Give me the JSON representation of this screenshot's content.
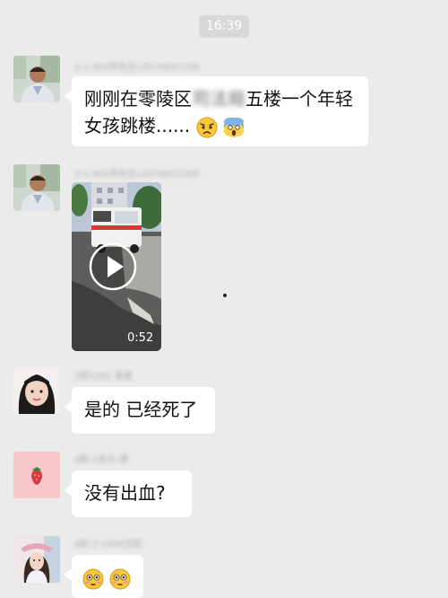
{
  "timestamp": "16:39",
  "messages": [
    {
      "sender": "2-1-403李先生13574651339",
      "text_before": "刚刚在零陵区",
      "text_blurred": "司法局",
      "text_after": "五楼一个年轻女孩跳楼......",
      "emojis": [
        "worried-face-icon",
        "screaming-face-icon"
      ]
    },
    {
      "sender": "2-1-403李先生13574651339",
      "video_duration": "0:52"
    },
    {
      "sender": "2栋1301 夏夏",
      "text": "是的 已经死了"
    },
    {
      "sender": "4栋-3单元-谭",
      "text": "没有出血?"
    },
    {
      "sender": "8栋-2-1004王妮",
      "emojis": [
        "flushed-face-icon",
        "flushed-face-icon"
      ]
    }
  ],
  "colors": {
    "background": "#ebebeb",
    "bubble": "#ffffff",
    "timestamp_bg": "#d8d8d8"
  }
}
